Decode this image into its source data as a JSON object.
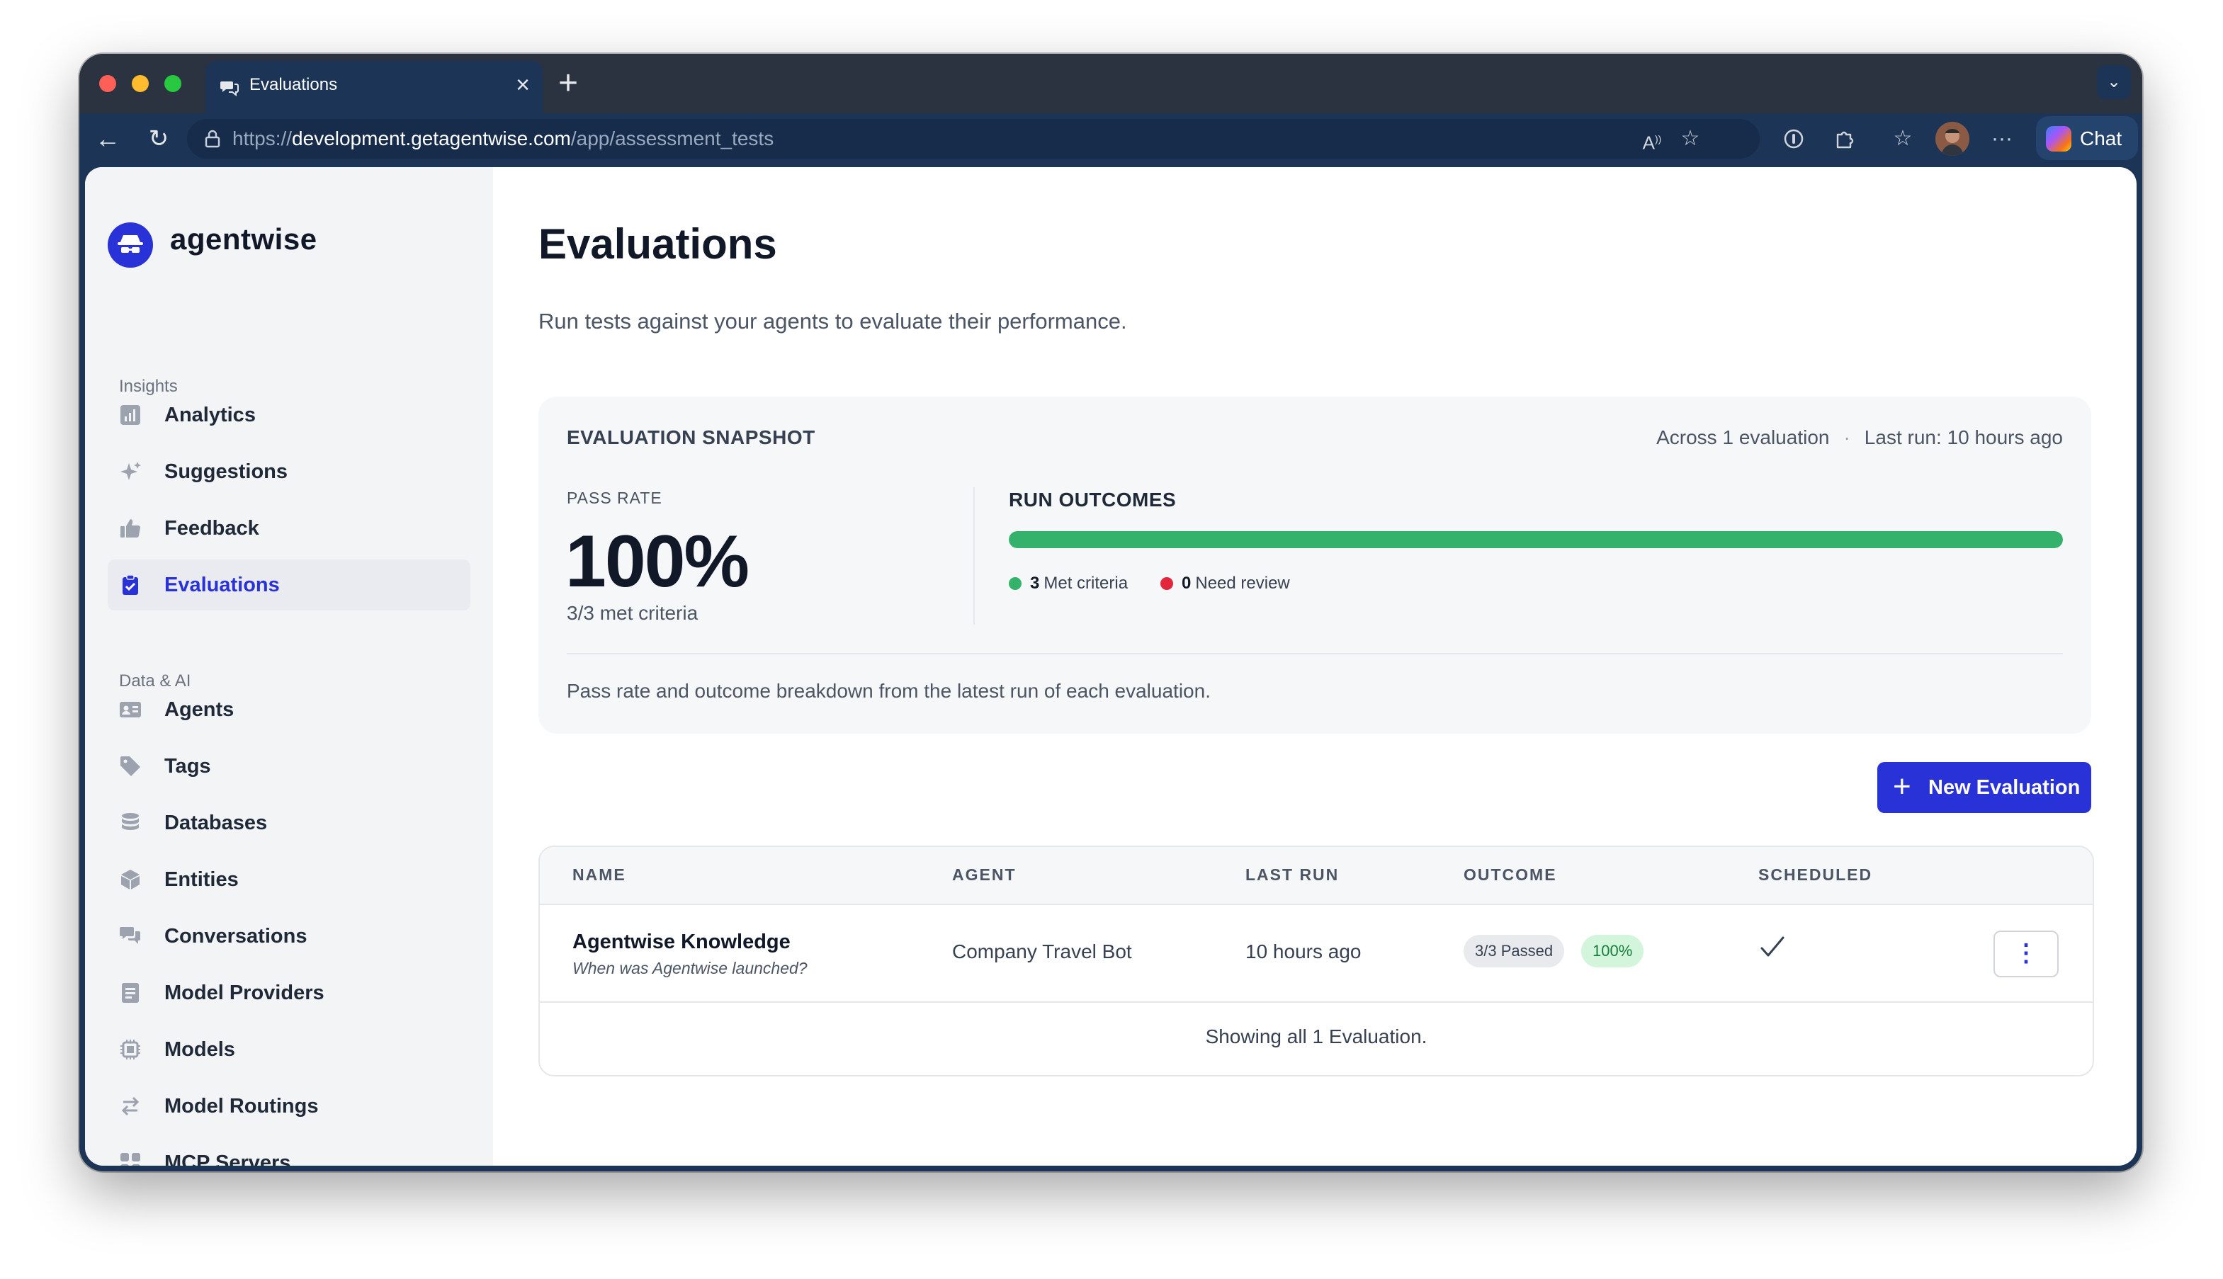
{
  "browser": {
    "tab_title": "Evaluations",
    "url_prefix": "https://",
    "url_host": "development.getagentwise.com",
    "url_path": "/app/assessment_tests",
    "chat_label": "Chat"
  },
  "brand": {
    "name": "agentwise",
    "color": "#2932d6"
  },
  "sidebar": {
    "section_insights": "Insights",
    "insights": [
      {
        "label": "Analytics",
        "icon": "bar-chart-icon"
      },
      {
        "label": "Suggestions",
        "icon": "sparkles-icon"
      },
      {
        "label": "Feedback",
        "icon": "thumbs-up-icon"
      },
      {
        "label": "Evaluations",
        "icon": "clipboard-check-icon",
        "active": true
      }
    ],
    "section_data": "Data & AI",
    "data": [
      {
        "label": "Agents",
        "icon": "id-card-icon"
      },
      {
        "label": "Tags",
        "icon": "tag-icon"
      },
      {
        "label": "Databases",
        "icon": "database-icon"
      },
      {
        "label": "Entities",
        "icon": "cube-icon"
      },
      {
        "label": "Conversations",
        "icon": "chat-bubbles-icon"
      },
      {
        "label": "Model Providers",
        "icon": "document-icon"
      },
      {
        "label": "Models",
        "icon": "chip-icon"
      },
      {
        "label": "Model Routings",
        "icon": "arrows-icon"
      },
      {
        "label": "MCP Servers",
        "icon": "grid-icon"
      }
    ]
  },
  "page": {
    "title": "Evaluations",
    "subtitle": "Run tests against your agents to evaluate their performance."
  },
  "snapshot": {
    "title": "EVALUATION SNAPSHOT",
    "meta_count": "Across 1 evaluation",
    "meta_separator": "·",
    "meta_last_run": "Last run: 10 hours ago",
    "pass_rate_label": "PASS RATE",
    "pass_rate_value": "100%",
    "pass_rate_sub": "3/3 met criteria",
    "outcomes_title": "RUN OUTCOMES",
    "outcome_fraction_met": 1.0,
    "met_count": "3",
    "met_label": "Met criteria",
    "review_count": "0",
    "review_label": "Need review",
    "met_color": "#34b26c",
    "review_color": "#e3263b",
    "footer": "Pass rate and outcome breakdown from the latest run of each evaluation."
  },
  "actions": {
    "new_evaluation": "New Evaluation"
  },
  "table": {
    "headers": [
      "NAME",
      "AGENT",
      "LAST RUN",
      "OUTCOME",
      "SCHEDULED"
    ],
    "rows": [
      {
        "name": "Agentwise Knowledge",
        "question": "When was Agentwise launched?",
        "agent": "Company Travel Bot",
        "last_run": "10 hours ago",
        "outcome_passed": "3/3 Passed",
        "outcome_percent": "100%",
        "scheduled": true
      }
    ],
    "footer": "Showing all 1 Evaluation."
  }
}
